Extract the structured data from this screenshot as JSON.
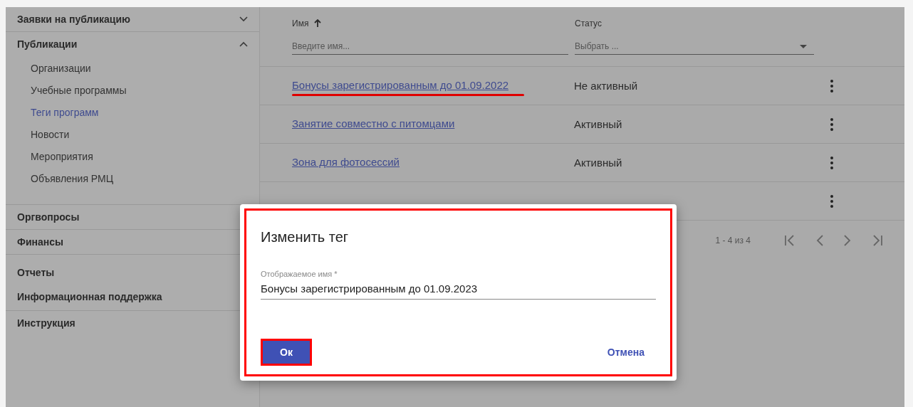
{
  "sidebar": {
    "sections": [
      {
        "groups": [
          {
            "label": "Заявки на публикацию",
            "expanded": false
          }
        ]
      },
      {
        "groups": [
          {
            "label": "Публикации",
            "expanded": true,
            "children": [
              {
                "label": "Организации",
                "selected": false
              },
              {
                "label": "Учебные программы",
                "selected": false
              },
              {
                "label": "Теги программ",
                "selected": true
              },
              {
                "label": "Новости",
                "selected": false
              },
              {
                "label": "Мероприятия",
                "selected": false
              },
              {
                "label": "Объявления РМЦ",
                "selected": false
              }
            ]
          }
        ]
      },
      {
        "groups": [
          {
            "label": "Оргвопросы"
          }
        ]
      },
      {
        "groups": [
          {
            "label": "Финансы"
          }
        ]
      },
      {
        "groups": [
          {
            "label": "Отчеты"
          },
          {
            "label": "Информационная поддержка"
          }
        ]
      },
      {
        "groups": [
          {
            "label": "Инструкция"
          }
        ]
      }
    ]
  },
  "table": {
    "columns": [
      {
        "label": "Имя",
        "sorted": true,
        "filter": {
          "kind": "text",
          "placeholder": "Введите имя..."
        }
      },
      {
        "label": "Статус",
        "filter": {
          "kind": "select",
          "placeholder": "Выбрать ..."
        }
      }
    ],
    "rows": [
      {
        "name": "Бонусы зарегистрированным до 01.09.2022",
        "status": "Не активный",
        "marked": true
      },
      {
        "name": "Занятие совместно с питомцами",
        "status": "Активный",
        "marked": false
      },
      {
        "name": "Зона для фотосессий",
        "status": "Активный",
        "marked": false
      },
      {
        "marked": false
      }
    ]
  },
  "pagination": {
    "range": "1 - 4 из 4"
  },
  "dialog": {
    "title": "Изменить тег",
    "marked": true,
    "field": {
      "label": "Отображаемое имя *",
      "value": "Бонусы зарегистрированным до 01.09.2023"
    },
    "ok_button": {
      "label": "Ок",
      "marked": true
    },
    "cancel_button": {
      "label": "Отмена"
    }
  }
}
